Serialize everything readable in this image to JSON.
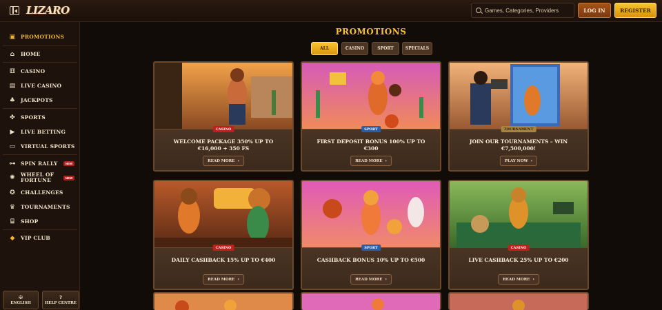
{
  "header": {
    "logo": "LIZARO",
    "search_placeholder": "Games, Categories, Providers",
    "login_label": "LOG IN",
    "register_label": "REGISTER"
  },
  "sidebar": {
    "items": [
      {
        "label": "PROMOTIONS",
        "icon": "gift-icon",
        "active": true
      },
      {
        "label": "HOME",
        "icon": "home-icon"
      },
      {
        "label": "CASINO",
        "icon": "slot-machine-icon"
      },
      {
        "label": "LIVE CASINO",
        "icon": "cards-icon"
      },
      {
        "label": "JACKPOTS",
        "icon": "clover-icon"
      },
      {
        "label": "SPORTS",
        "icon": "ball-icon"
      },
      {
        "label": "LIVE BETTING",
        "icon": "play-icon"
      },
      {
        "label": "VIRTUAL SPORTS",
        "icon": "monitor-icon"
      },
      {
        "label": "SPIN RALLY",
        "icon": "car-icon",
        "badge": "NEW"
      },
      {
        "label": "WHEEL OF FORTUNE",
        "icon": "wheel-icon",
        "badge": "NEW"
      },
      {
        "label": "CHALLENGES",
        "icon": "medal-icon"
      },
      {
        "label": "TOURNAMENTS",
        "icon": "trophy-icon"
      },
      {
        "label": "SHOP",
        "icon": "shop-icon"
      },
      {
        "label": "VIP CLUB",
        "icon": "diamond-icon"
      }
    ],
    "language_label": "ENGLISH",
    "help_label": "HELP CENTRE"
  },
  "main": {
    "title": "PROMOTIONS",
    "filters": [
      "ALL",
      "CASINO",
      "SPORT",
      "SPECIALS"
    ],
    "active_filter": "ALL",
    "cards": [
      {
        "tag": "CASINO",
        "title": "WELCOME PACKAGE 350% UP TO €16,000 + 350 FS",
        "button": "READ MORE"
      },
      {
        "tag": "SPORT",
        "title": "FIRST DEPOSIT BONUS 100% UP TO €300",
        "button": "READ MORE"
      },
      {
        "tag": "TOURNAMENT",
        "title": "JOIN OUR TOURNAMENTS – WIN €7,500,000!",
        "button": "PLAY NOW"
      },
      {
        "tag": "CASINO",
        "title": "DAILY CASHBACK 15% UP TO €400",
        "button": "READ MORE"
      },
      {
        "tag": "SPORT",
        "title": "CASHBACK BONUS 10% UP TO €500",
        "button": "READ MORE"
      },
      {
        "tag": "CASINO",
        "title": "LIVE CASHBACK 25% UP TO €200",
        "button": "READ MORE"
      }
    ]
  },
  "colors": {
    "accent": "#f4b52e",
    "background": "#120c08",
    "casino_tag": "#c21e1e",
    "sport_tag": "#2a5ea8"
  }
}
